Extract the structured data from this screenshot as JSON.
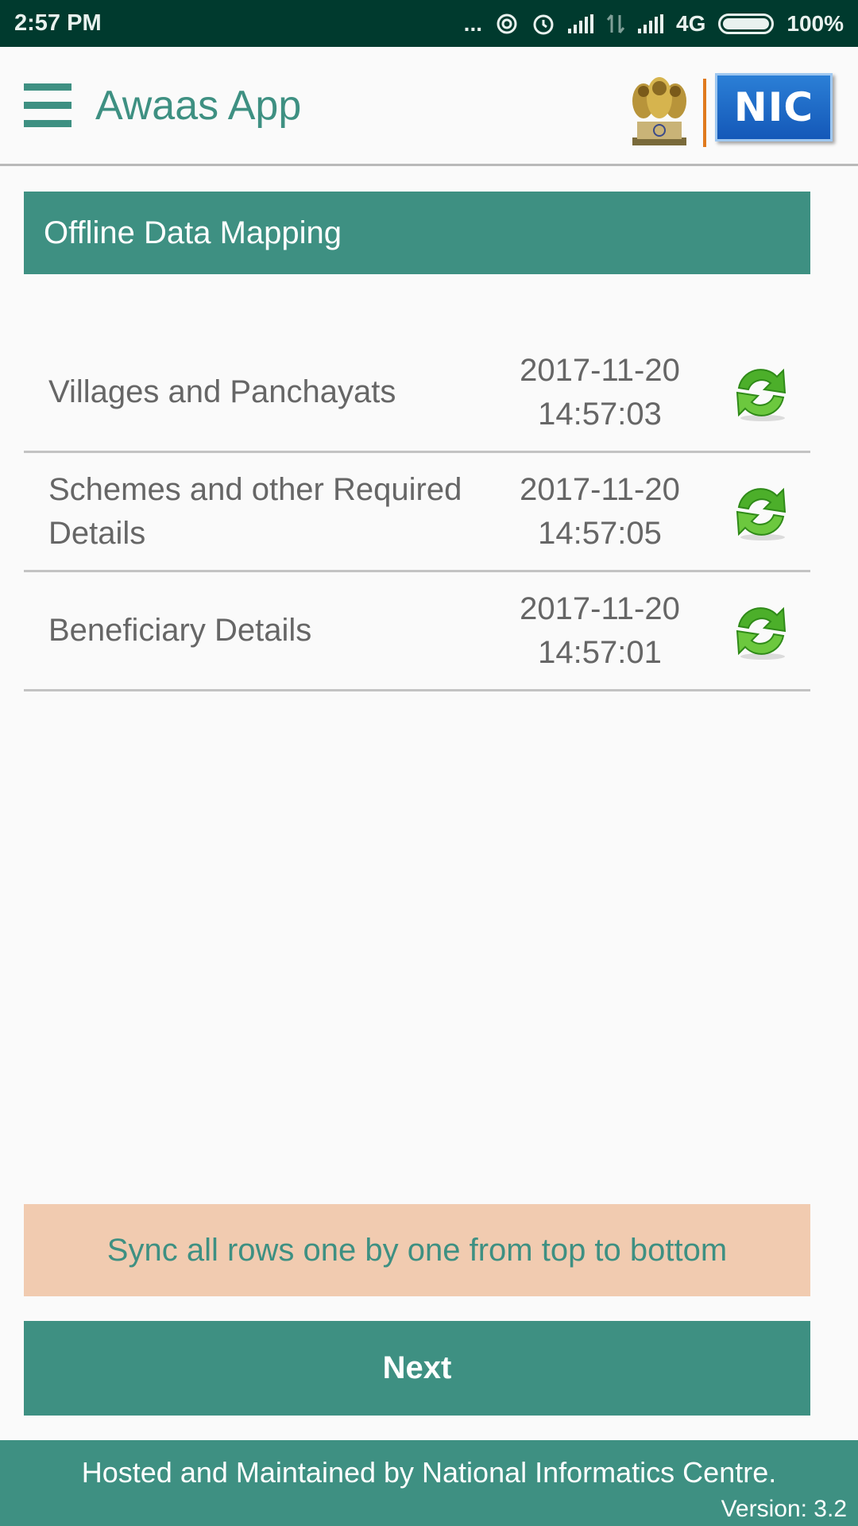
{
  "status_bar": {
    "time": "2:57 PM",
    "more_glyph": "...",
    "network_type": "4G",
    "battery": "100%",
    "icons": [
      "more-dots-icon",
      "hotspot-icon",
      "alarm-icon",
      "signal-icon",
      "data-arrows-icon",
      "signal-icon",
      "battery-icon"
    ]
  },
  "app_bar": {
    "title": "Awaas App",
    "logo_text": "NIC",
    "icons": [
      "menu-icon",
      "emblem-logo",
      "nic-logo"
    ]
  },
  "section": {
    "title": "Offline Data Mapping"
  },
  "rows": [
    {
      "label": "Villages and Panchayats",
      "date": "2017-11-20",
      "time": "14:57:03",
      "icon": "sync-icon"
    },
    {
      "label": "Schemes and other Required Details",
      "date": "2017-11-20",
      "time": "14:57:05",
      "icon": "sync-icon"
    },
    {
      "label": "Beneficiary Details",
      "date": "2017-11-20",
      "time": "14:57:01",
      "icon": "sync-icon"
    }
  ],
  "note": "Sync all rows one by one from top to bottom",
  "next_button": "Next",
  "footer": {
    "text": "Hosted and Maintained by National Informatics Centre.",
    "version": "Version: 3.2"
  },
  "colors": {
    "primary": "#3e9082",
    "status_bar": "#003a2e",
    "note_bg": "#f1cbb0",
    "nic_blue": "#1f6fcf",
    "sync_green": "#4caf2a"
  }
}
